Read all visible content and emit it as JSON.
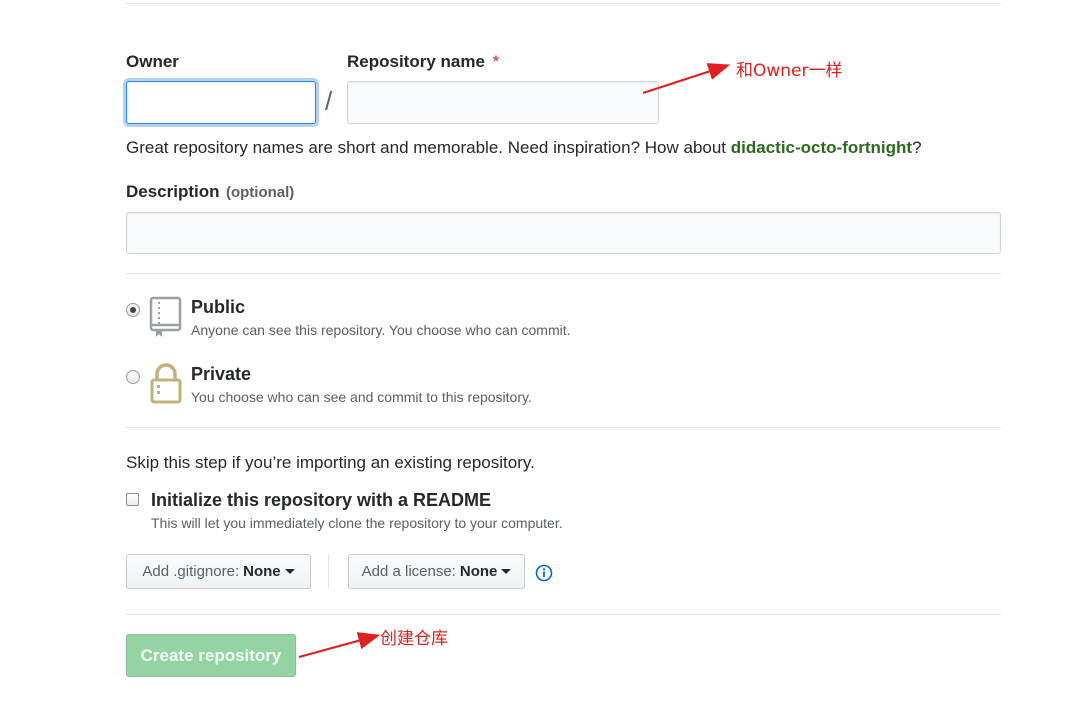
{
  "owner": {
    "label": "Owner",
    "value": ""
  },
  "separator": "/",
  "repo_name": {
    "label": "Repository name",
    "required_mark": "*",
    "value": ""
  },
  "hint": {
    "prefix": "Great repository names are short and memorable. Need inspiration? How about ",
    "suggestion": "didactic-octo-fortnight",
    "suffix": "?"
  },
  "description": {
    "label": "Description",
    "optional": "(optional)",
    "value": ""
  },
  "visibility": {
    "public": {
      "title": "Public",
      "note": "Anyone can see this repository. You choose who can commit.",
      "checked": true
    },
    "private": {
      "title": "Private",
      "note": "You choose who can see and commit to this repository.",
      "checked": false
    }
  },
  "skip_text": "Skip this step if you’re importing an existing repository.",
  "readme": {
    "title": "Initialize this repository with a README",
    "note": "This will let you immediately clone the repository to your computer.",
    "checked": false
  },
  "gitignore": {
    "prefix": "Add .gitignore:",
    "value": "None"
  },
  "license": {
    "prefix": "Add a license:",
    "value": "None"
  },
  "info_icon": "info-icon",
  "create_button": "Create repository",
  "annotations": {
    "same_as_owner": "和Owner一样",
    "create_repo": "创建仓库"
  },
  "colors": {
    "suggestion": "#28a745",
    "create_button_bg": "#94d3a2",
    "annotation": "#e02020",
    "focus_ring": "#2188ff"
  }
}
